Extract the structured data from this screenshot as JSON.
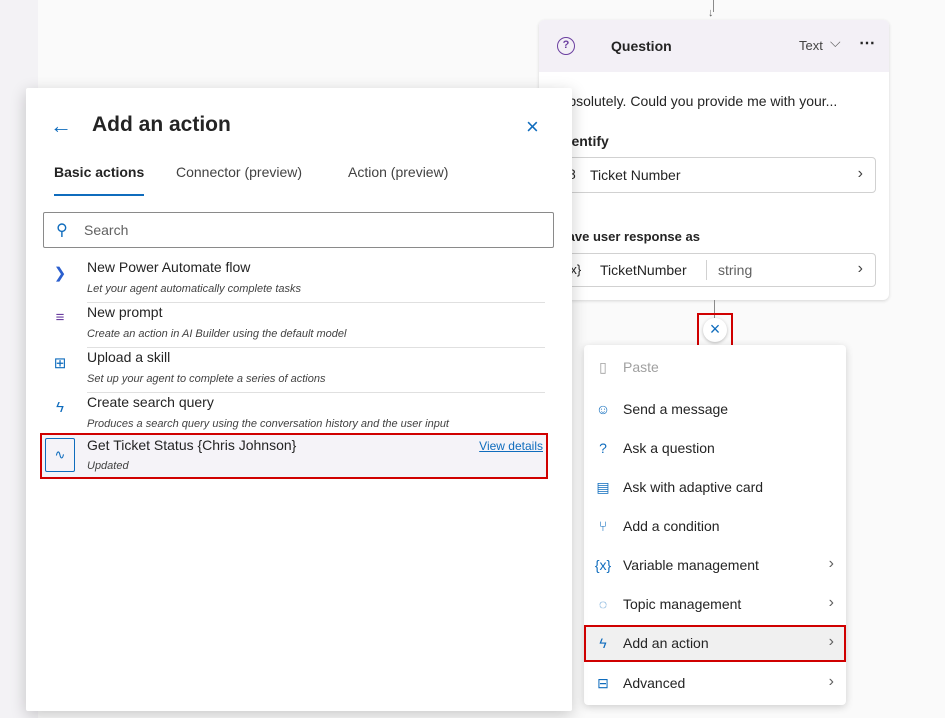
{
  "question_card": {
    "title": "Question",
    "type_label": "Text",
    "message": "Absolutely. Could you provide me with your...",
    "identify_label": "Identify",
    "identify_value": "Ticket Number",
    "save_label": "Save user response as",
    "variable_icon": "{x}",
    "variable_name": "TicketNumber",
    "variable_type": "string"
  },
  "node_menu": {
    "items": [
      {
        "label": "Paste",
        "icon": "paste-icon"
      },
      {
        "label": "Send a message",
        "icon": "message-icon"
      },
      {
        "label": "Ask a question",
        "icon": "question-icon"
      },
      {
        "label": "Ask with adaptive card",
        "icon": "card-icon"
      },
      {
        "label": "Add a condition",
        "icon": "branch-icon"
      },
      {
        "label": "Variable management",
        "icon": "variable-icon"
      },
      {
        "label": "Topic management",
        "icon": "topic-icon"
      },
      {
        "label": "Add an action",
        "icon": "lightning-icon"
      },
      {
        "label": "Advanced",
        "icon": "briefcase-icon"
      }
    ]
  },
  "panel": {
    "title": "Add an action",
    "tabs": [
      "Basic actions",
      "Connector (preview)",
      "Action (preview)"
    ],
    "search_placeholder": "Search",
    "actions": [
      {
        "title": "New Power Automate flow",
        "desc": "Let your agent automatically complete tasks",
        "icon": "power-automate-icon"
      },
      {
        "title": "New prompt",
        "desc": "Create an action in AI Builder using the default model",
        "icon": "prompt-icon"
      },
      {
        "title": "Upload a skill",
        "desc": "Set up your agent to complete a series of actions",
        "icon": "skill-icon"
      },
      {
        "title": "Create search query",
        "desc": "Produces a search query using the conversation history and the user input",
        "icon": "lightning-icon"
      },
      {
        "title": "Get Ticket Status {Chris Johnson}",
        "desc": "Updated",
        "icon": "flow-icon",
        "link": "View details"
      }
    ]
  },
  "colors": {
    "accent": "#0f6cbd",
    "highlight": "#d00000",
    "question_header": "#f3f0f6"
  }
}
